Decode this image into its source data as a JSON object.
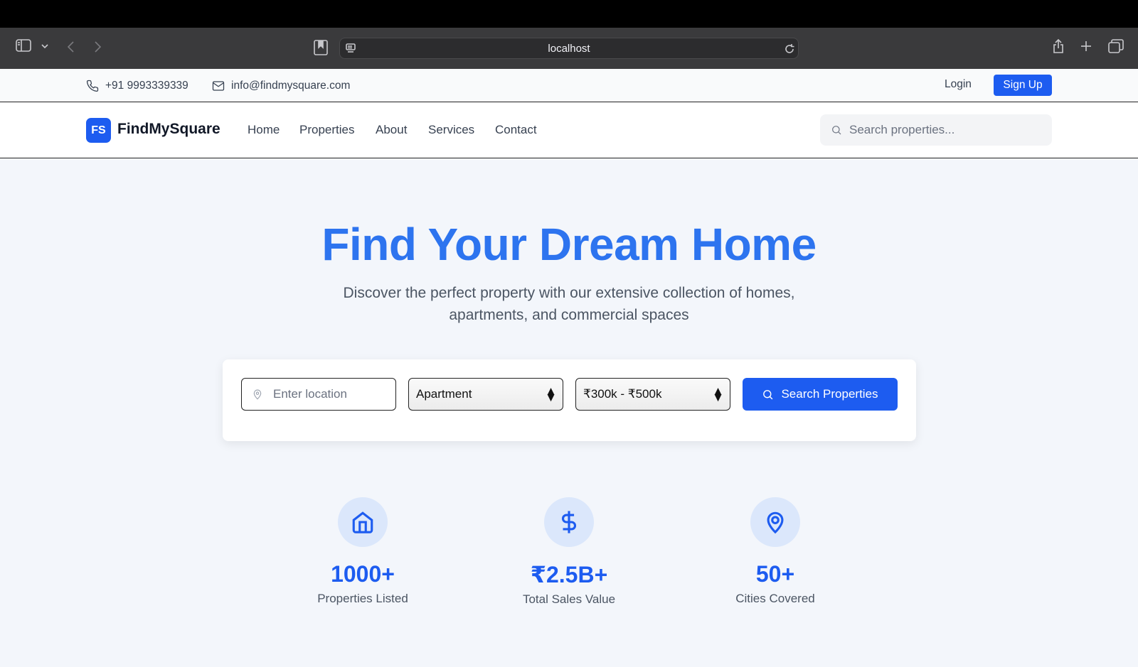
{
  "browser": {
    "url": "localhost"
  },
  "info_bar": {
    "phone": "+91 9993339339",
    "email": "info@findmysquare.com",
    "login_label": "Login",
    "signup_label": "Sign Up"
  },
  "nav": {
    "logo_badge": "FS",
    "brand": "FindMySquare",
    "links": [
      "Home",
      "Properties",
      "About",
      "Services",
      "Contact"
    ],
    "search_placeholder": "Search properties..."
  },
  "hero": {
    "title": "Find Your Dream Home",
    "subtitle_line1": "Discover the perfect property with our extensive collection of homes,",
    "subtitle_line2": "apartments, and commercial spaces"
  },
  "search_form": {
    "location_placeholder": "Enter location",
    "property_type": "Apartment",
    "price_range": "₹300k - ₹500k",
    "button_label": "Search Properties"
  },
  "stats": [
    {
      "value": "1000+",
      "label": "Properties Listed",
      "icon": "home-icon"
    },
    {
      "value": "₹2.5B+",
      "label": "Total Sales Value",
      "icon": "dollar-icon"
    },
    {
      "value": "50+",
      "label": "Cities Covered",
      "icon": "map-pin-icon"
    }
  ],
  "colors": {
    "primary": "#1d5cf0",
    "hero_title": "#2d74ef",
    "page_bg": "#f3f6fb"
  }
}
